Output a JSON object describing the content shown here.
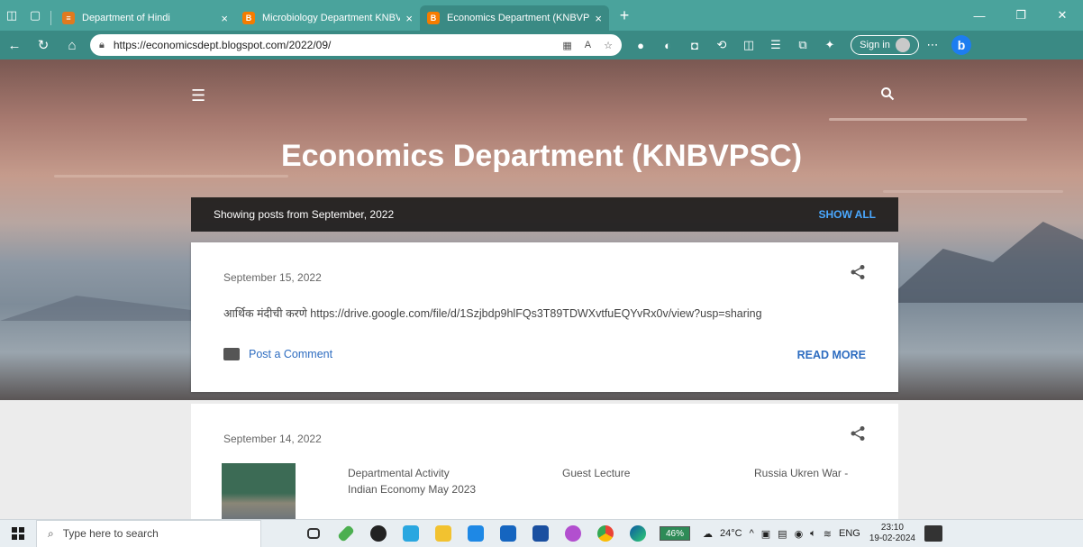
{
  "browser": {
    "tabs": [
      {
        "title": "Department of Hindi",
        "favicon_color": "#e07a1f",
        "active": false
      },
      {
        "title": "Microbiology Department KNBVP",
        "favicon_color": "#f57c00",
        "active": false
      },
      {
        "title": "Economics Department (KNBVPS",
        "favicon_color": "#f57c00",
        "active": true
      }
    ],
    "url": "https://economicsdept.blogspot.com/2022/09/",
    "sign_in_label": "Sign in",
    "bing_label": "b",
    "accent": "#4aa39c"
  },
  "blog": {
    "title": "Economics Department (KNBVPSC)",
    "filter_label": "Showing posts from September, 2022",
    "show_all_label": "SHOW ALL",
    "posts": [
      {
        "date": "September 15, 2022",
        "excerpt": "आर्थिक मंदीची करणे  https://drive.google.com/file/d/1Szjbdp9hlFQs3T89TDWXvtfuEQYvRx0v/view?usp=sharing",
        "comment_label": "Post a Comment",
        "read_more_label": "READ MORE"
      },
      {
        "date": "September 14, 2022",
        "related": [
          {
            "line1": "Departmental Activity",
            "line2": "Indian Economy  May 2023"
          },
          {
            "line1": "Guest Lecture",
            "line2": ""
          },
          {
            "line1": "Russia Ukren War -",
            "line2": ""
          }
        ]
      }
    ]
  },
  "taskbar": {
    "search_placeholder": "Type here to search",
    "battery": "46%",
    "weather": "24°C",
    "language": "ENG",
    "time": "23:10",
    "date": "19-02-2024"
  }
}
